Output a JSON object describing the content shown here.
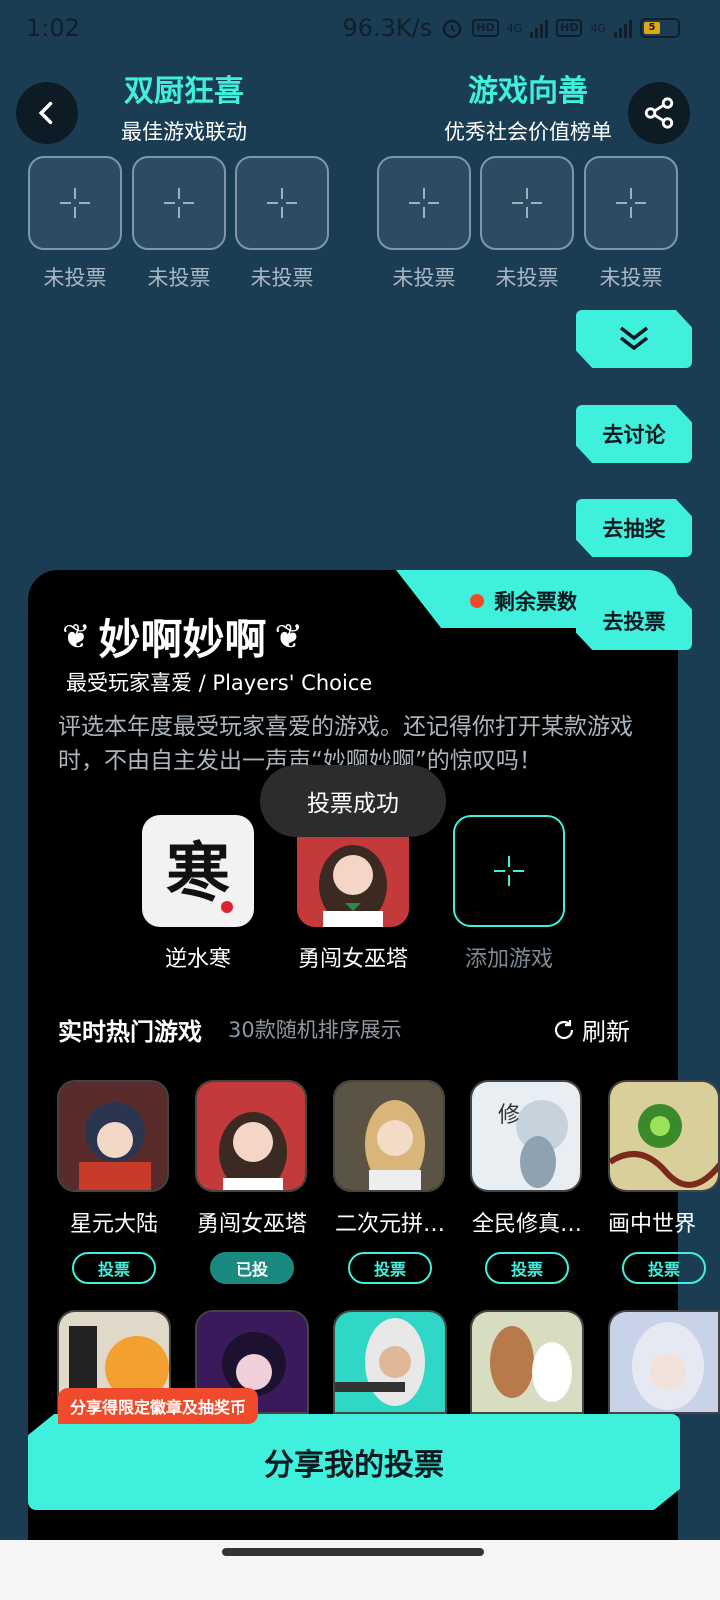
{
  "status": {
    "time": "1:02",
    "speed": "96.3K/s",
    "hd1": "HD",
    "hd2": "HD",
    "net1": "4G",
    "net2": "4G",
    "battery": "5"
  },
  "header": {
    "left_category": {
      "title": "双厨狂喜",
      "subtitle": "最佳游戏联动"
    },
    "right_category": {
      "title": "游戏向善",
      "subtitle": "优秀社会价值榜单"
    },
    "slot_label": "未投票"
  },
  "side_buttons": {
    "discuss": "去讨论",
    "lottery": "去抽奖",
    "vote": "去投票"
  },
  "card": {
    "tickets_label": "剩余票数",
    "award_title": "妙啊妙啊",
    "award_subtitle": "最受玩家喜爱 / Players' Choice",
    "award_desc": "评选本年度最受玩家喜爱的游戏。还记得你打开某款游戏时，不由自主发出一声声“妙啊妙啊”的惊叹吗！",
    "toast": "投票成功",
    "voted": [
      {
        "name": "逆水寒"
      },
      {
        "name": "勇闯女巫塔"
      }
    ],
    "add_label": "添加游戏",
    "hot_title": "实时热门游戏",
    "hot_sub": "30款随机排序展示",
    "refresh": "刷新",
    "games": [
      {
        "name": "星元大陆",
        "btn": "投票"
      },
      {
        "name": "勇闯女巫塔",
        "btn": "已投"
      },
      {
        "name": "二次元拼…",
        "btn": "投票"
      },
      {
        "name": "全民修真…",
        "btn": "投票"
      },
      {
        "name": "画中世界",
        "btn": "投票"
      }
    ],
    "promo": "分享得限定徽章及抽奖币",
    "share_button": "分享我的投票"
  },
  "colors": {
    "accent": "#3ff0dc",
    "bg": "#1b3d54",
    "card": "#000000",
    "alert": "#ef4b2c"
  }
}
